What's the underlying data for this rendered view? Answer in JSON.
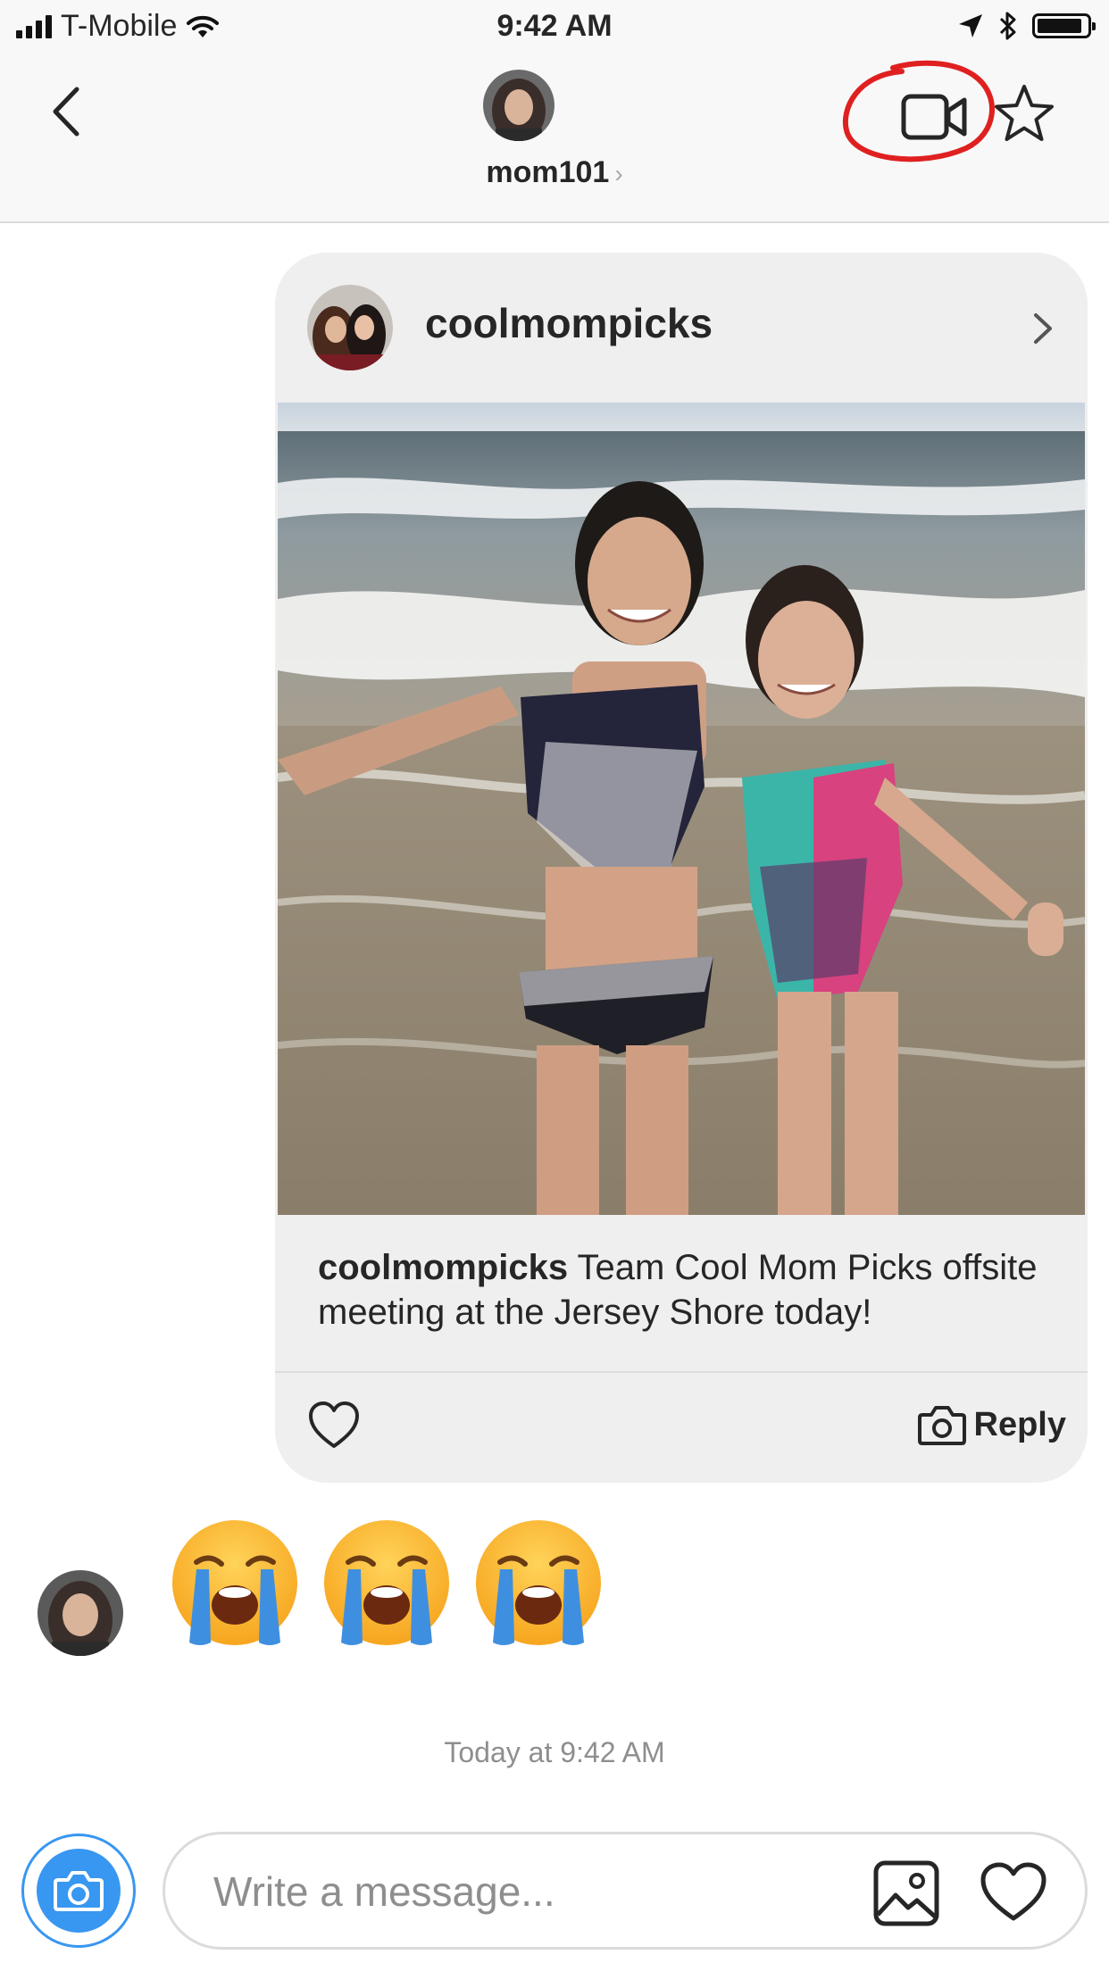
{
  "status_bar": {
    "carrier": "T-Mobile",
    "time": "9:42 AM",
    "icons": [
      "signal-icon",
      "wifi-icon",
      "location-arrow-icon",
      "bluetooth-icon",
      "battery-icon"
    ]
  },
  "header": {
    "username": "mom101",
    "chevron": "›",
    "icons": [
      "back-icon",
      "video-call-icon",
      "star-icon"
    ],
    "highlight_color": "#e02020"
  },
  "shared_post": {
    "username": "coolmompicks",
    "caption_user": "coolmompicks",
    "caption_text": " Team Cool Mom Picks offsite meeting at the Jersey Shore today!",
    "reply_label": "Reply",
    "icons": [
      "chevron-right-icon",
      "heart-icon",
      "camera-icon"
    ]
  },
  "messages": {
    "emoji_message": [
      "😭",
      "😭",
      "😭"
    ]
  },
  "timestamp": "Today at 9:42 AM",
  "composer": {
    "placeholder": "Write a message...",
    "icons": [
      "camera-icon",
      "gallery-icon",
      "heart-icon"
    ],
    "accent_color": "#3897f0"
  }
}
